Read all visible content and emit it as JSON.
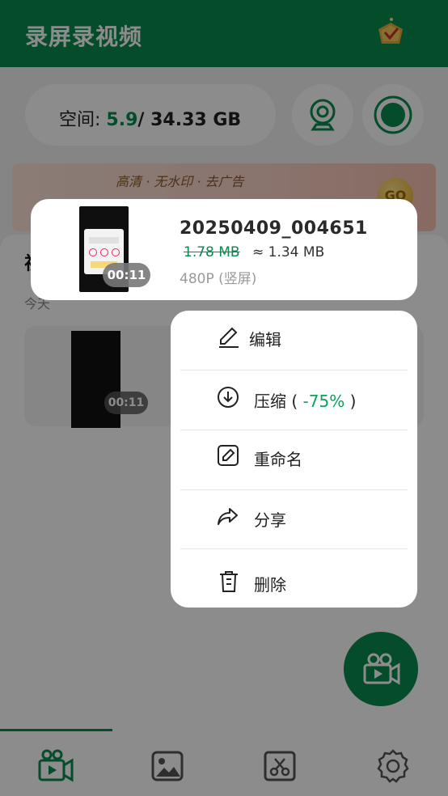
{
  "app": {
    "title": "录屏录视频",
    "storage_label": "空间:",
    "storage_used": "5.9",
    "storage_total": "/ 34.33 GB",
    "banner_text": "高清 · 无水印 · 去广告",
    "banner_button": "GO",
    "section_title": "视频",
    "section_date": "今天",
    "list_item_duration": "00:11"
  },
  "focused_item": {
    "filename": "20250409_004651",
    "original_size": "1.78 MB",
    "compressed_size": "≈ 1.34 MB",
    "resolution": "480P (竖屏)",
    "duration": "00:11"
  },
  "menu": {
    "edit": "编辑",
    "compress_label": "压缩",
    "compress_open": "(",
    "compress_percent": "-75%",
    "compress_close": ")",
    "rename": "重命名",
    "share": "分享",
    "delete": "删除"
  },
  "colors": {
    "brand": "#0a8a4e",
    "accent_percent": "#0aa35a"
  },
  "bottom_nav": {
    "items": [
      "video-camera-icon",
      "gallery-icon",
      "cut-icon",
      "settings-icon"
    ],
    "active": "video-camera-icon"
  }
}
